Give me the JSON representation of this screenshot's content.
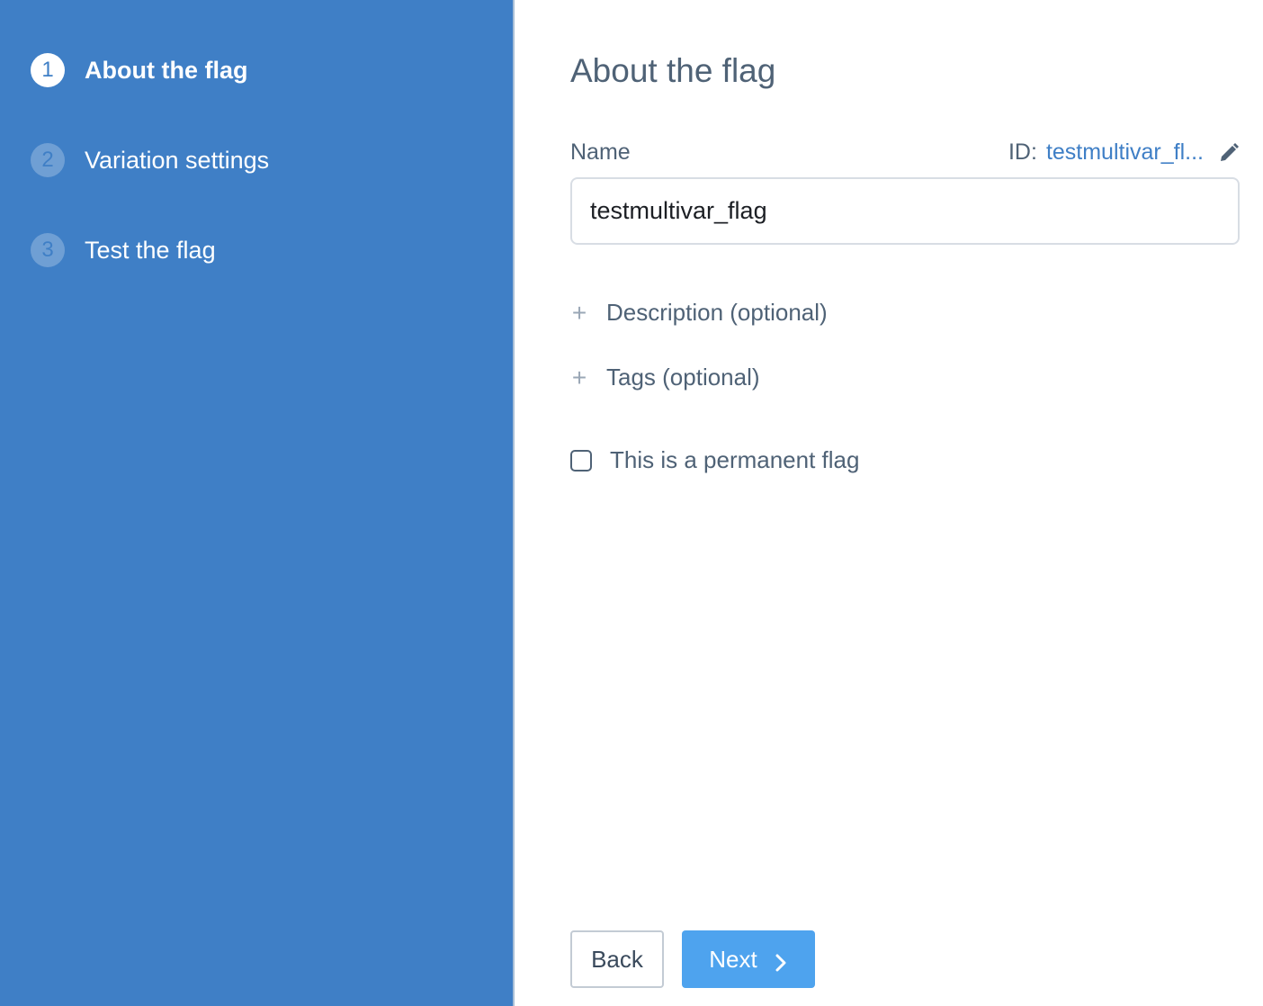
{
  "sidebar": {
    "steps": [
      {
        "number": "1",
        "label": "About the flag",
        "active": true
      },
      {
        "number": "2",
        "label": "Variation settings",
        "active": false
      },
      {
        "number": "3",
        "label": "Test the flag",
        "active": false
      }
    ]
  },
  "main": {
    "title": "About the flag",
    "name_label": "Name",
    "id_prefix": "ID:",
    "id_value": "testmultivar_fl...",
    "name_value": "testmultivar_flag",
    "description_toggle": "Description (optional)",
    "tags_toggle": "Tags (optional)",
    "permanent_checkbox_label": "This is a permanent flag",
    "permanent_checked": false
  },
  "footer": {
    "back_label": "Back",
    "next_label": "Next"
  },
  "colors": {
    "sidebar_bg": "#3f7fc6",
    "primary_button": "#4ea3ee",
    "text_muted": "#4f6276",
    "link": "#3f7fc6"
  },
  "icons": {
    "edit": "pencil-icon",
    "expand": "plus-icon",
    "next": "chevron-right-icon"
  }
}
